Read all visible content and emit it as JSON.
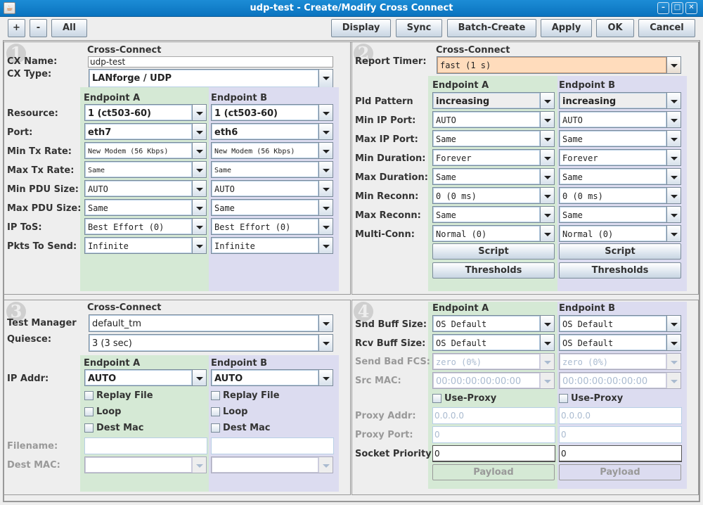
{
  "window": {
    "title": "udp-test - Create/Modify Cross Connect",
    "controls": [
      "minimize",
      "maximize",
      "close"
    ]
  },
  "toolbar": {
    "plus": "+",
    "minus": "-",
    "all": "All",
    "display": "Display",
    "sync": "Sync",
    "batch_create": "Batch-Create",
    "apply": "Apply",
    "ok": "OK",
    "cancel": "Cancel"
  },
  "panel1": {
    "number": "1",
    "cross_connect_header": "Cross-Connect",
    "cx_name_label": "CX Name:",
    "cx_name_value": "udp-test",
    "cx_type_label": "CX Type:",
    "cx_type_value": "LANforge / UDP",
    "endpoint_a": "Endpoint A",
    "endpoint_b": "Endpoint B",
    "rows": [
      {
        "label": "Resource:",
        "a": "1 (ct503-60)",
        "b": "1 (ct503-60)"
      },
      {
        "label": "Port:",
        "a": "eth7",
        "b": "eth6"
      },
      {
        "label": "Min Tx Rate:",
        "a": "New Modem (56 Kbps)",
        "b": "New Modem (56 Kbps)"
      },
      {
        "label": "Max Tx Rate:",
        "a": "Same",
        "b": "Same"
      },
      {
        "label": "Min PDU Size:",
        "a": "AUTO",
        "b": "AUTO"
      },
      {
        "label": "Max PDU Size:",
        "a": "Same",
        "b": "Same"
      },
      {
        "label": "IP ToS:",
        "a": "Best Effort    (0)",
        "b": "Best Effort    (0)"
      },
      {
        "label": "Pkts To Send:",
        "a": "Infinite",
        "b": "Infinite"
      }
    ]
  },
  "panel2": {
    "number": "2",
    "cross_connect_header": "Cross-Connect",
    "report_timer_label": "Report Timer:",
    "report_timer_value": "fast     (1 s)",
    "endpoint_a": "Endpoint A",
    "endpoint_b": "Endpoint B",
    "rows": [
      {
        "label": "Pld Pattern",
        "a": "increasing",
        "b": "increasing"
      },
      {
        "label": "Min IP Port:",
        "a": "AUTO",
        "b": "AUTO"
      },
      {
        "label": "Max IP Port:",
        "a": "Same",
        "b": "Same"
      },
      {
        "label": "Min Duration:",
        "a": "Forever",
        "b": "Forever"
      },
      {
        "label": "Max Duration:",
        "a": "Same",
        "b": "Same"
      },
      {
        "label": "Min Reconn:",
        "a": "0     (0 ms)",
        "b": "0     (0 ms)"
      },
      {
        "label": "Max Reconn:",
        "a": "Same",
        "b": "Same"
      },
      {
        "label": "Multi-Conn:",
        "a": "Normal (0)",
        "b": "Normal (0)"
      }
    ],
    "script_label": "Script",
    "thresholds_label": "Thresholds"
  },
  "panel3": {
    "number": "3",
    "cross_connect_header": "Cross-Connect",
    "test_manager_label": "Test Manager",
    "test_manager_value": "default_tm",
    "quiesce_label": "Quiesce:",
    "quiesce_value": "3 (3 sec)",
    "endpoint_a": "Endpoint A",
    "endpoint_b": "Endpoint B",
    "ip_addr_label": "IP Addr:",
    "ip_addr_a": "AUTO",
    "ip_addr_b": "AUTO",
    "replay_file": "Replay File",
    "loop": "Loop",
    "dest_mac_chk": "Dest Mac",
    "filename_label": "Filename:",
    "filename_a": "",
    "filename_b": "",
    "dest_mac_label": "Dest MAC:",
    "dest_mac_a": "",
    "dest_mac_b": ""
  },
  "panel4": {
    "number": "4",
    "endpoint_a": "Endpoint A",
    "endpoint_b": "Endpoint B",
    "snd_buff_label": "Snd Buff Size:",
    "snd_buff_a": "OS Default",
    "snd_buff_b": "OS Default",
    "rcv_buff_label": "Rcv Buff Size:",
    "rcv_buff_a": "OS Default",
    "rcv_buff_b": "OS Default",
    "bad_fcs_label": "Send Bad FCS:",
    "bad_fcs_a": "zero (0%)",
    "bad_fcs_b": "zero (0%)",
    "src_mac_label": "Src MAC:",
    "src_mac_a": "00:00:00:00:00:00",
    "src_mac_b": "00:00:00:00:00:00",
    "use_proxy": "Use-Proxy",
    "proxy_addr_label": "Proxy Addr:",
    "proxy_addr_a": "0.0.0.0",
    "proxy_addr_b": "0.0.0.0",
    "proxy_port_label": "Proxy Port:",
    "proxy_port_a": "0",
    "proxy_port_b": "0",
    "socket_priority_label": "Socket Priority:",
    "socket_priority_a": "0",
    "socket_priority_b": "0",
    "payload_label": "Payload"
  },
  "colors": {
    "endpoint_a_bg": "#d5e9d5",
    "endpoint_b_bg": "#dcdcf0",
    "report_timer_bg": "#ffdcbc",
    "titlebar": "#0a73bf"
  }
}
